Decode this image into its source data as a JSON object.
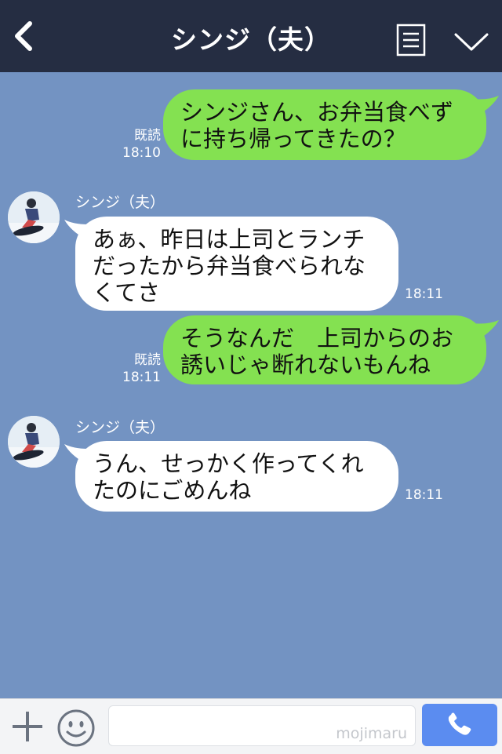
{
  "header": {
    "title": "シンジ（夫）"
  },
  "messages": [
    {
      "from": "me",
      "text": "シンジさん、お弁当食べず\nに持ち帰ってきたの？",
      "read": "既読",
      "time": "18:10"
    },
    {
      "from": "them",
      "sender": "シンジ（夫）",
      "text": "あぁ、昨日は上司とランチ\nだったから弁当食べられな\nくてさ",
      "time": "18:11"
    },
    {
      "from": "me",
      "text": "そうなんだ　上司からのお\n誘いじゃ断れないもんね",
      "read": "既読",
      "time": "18:11"
    },
    {
      "from": "them",
      "sender": "シンジ（夫）",
      "text": "うん、せっかく作ってくれ\nたのにごめんね",
      "time": "18:11"
    }
  ],
  "input": {
    "value": "",
    "watermark": "mojimaru"
  },
  "icons": {
    "back": "chevron-left-icon",
    "menu": "notes-icon",
    "more": "chevron-down-icon",
    "add": "plus-icon",
    "emoji": "smiley-icon",
    "call": "phone-icon"
  },
  "colors": {
    "header_bg": "#252d42",
    "chat_bg": "#7393c2",
    "my_bubble": "#84e151",
    "their_bubble": "#ffffff",
    "call_button": "#5b8cf0"
  }
}
